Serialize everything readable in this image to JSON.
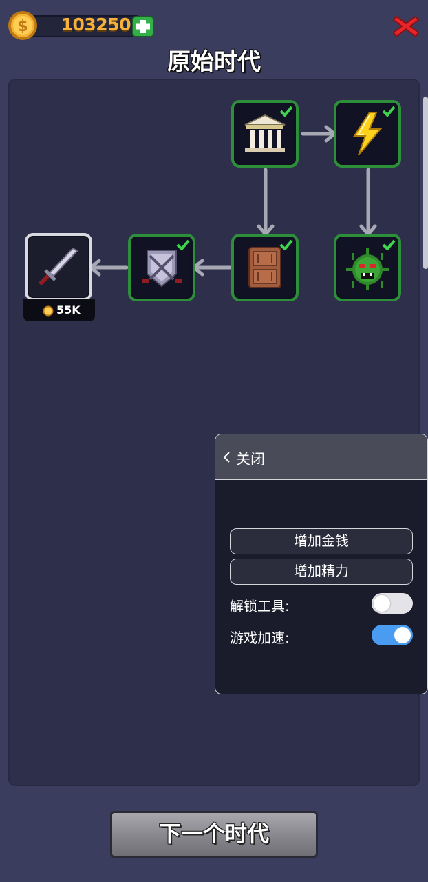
{
  "currency": {
    "amount": "103250",
    "coin_icon": "gold-coin-icon",
    "add_icon": "plus-icon",
    "accent": "#f6b03c"
  },
  "title": "原始时代",
  "tree": {
    "nodes": [
      {
        "id": "temple",
        "icon": "temple-icon",
        "unlocked": true
      },
      {
        "id": "lightning",
        "icon": "lightning-icon",
        "unlocked": true
      },
      {
        "id": "virus",
        "icon": "virus-monster-icon",
        "unlocked": true
      },
      {
        "id": "wooden-armor",
        "icon": "wooden-armor-icon",
        "unlocked": true
      },
      {
        "id": "shield",
        "icon": "crossed-swords-shield-icon",
        "unlocked": true
      },
      {
        "id": "sword",
        "icon": "sword-icon",
        "unlocked": false,
        "price": "55K"
      }
    ]
  },
  "mod_menu": {
    "close_label": "关闭",
    "add_money_label": "增加金钱",
    "add_energy_label": "增加精力",
    "unlock_tools_label": "解锁工具:",
    "unlock_tools_on": false,
    "game_speed_label": "游戏加速:",
    "game_speed_on": true
  },
  "next_era_label": "下一个时代"
}
